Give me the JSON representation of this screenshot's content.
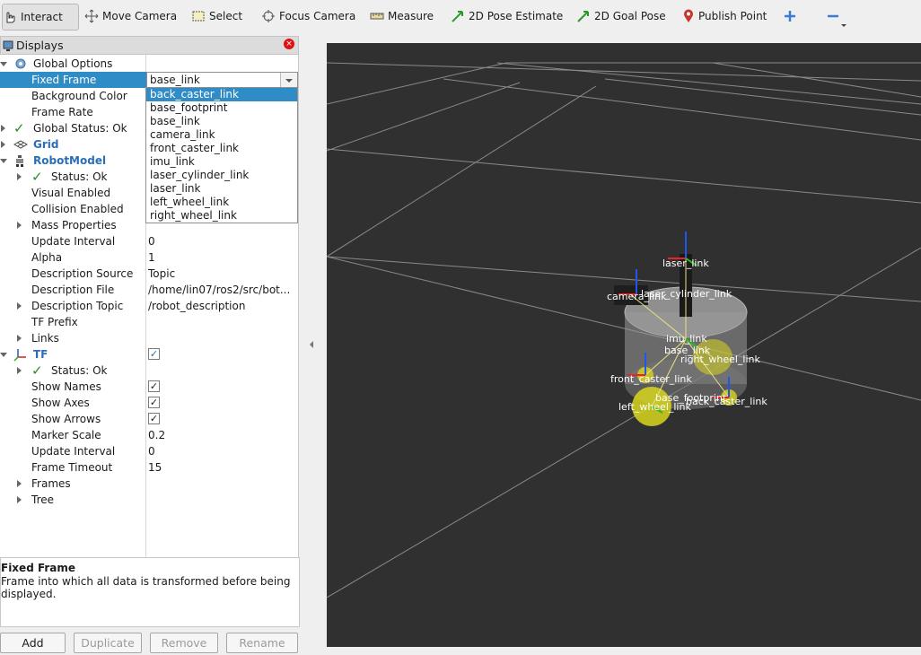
{
  "toolbar": {
    "interact": "Interact",
    "move_camera": "Move Camera",
    "select": "Select",
    "focus_camera": "Focus Camera",
    "measure": "Measure",
    "pose_estimate": "2D Pose Estimate",
    "goal_pose": "2D Goal Pose",
    "publish_point": "Publish Point"
  },
  "displays": {
    "title": "Displays",
    "close_glyph": "×",
    "global_options": "Global Options",
    "fixed_frame_label": "Fixed Frame",
    "fixed_frame_value": "base_link",
    "background_color": "Background Color",
    "frame_rate": "Frame Rate",
    "global_status": "Global Status: Ok",
    "grid": "Grid",
    "robot_model": "RobotModel",
    "rm_status": "Status: Ok",
    "visual_enabled": "Visual Enabled",
    "collision_enabled": "Collision Enabled",
    "mass_properties": "Mass Properties",
    "update_interval": "Update Interval",
    "update_interval_value": "0",
    "alpha": "Alpha",
    "alpha_value": "1",
    "description_source": "Description Source",
    "description_source_value": "Topic",
    "description_file": "Description File",
    "description_file_value": "/home/lin07/ros2/src/bot...",
    "description_topic": "Description Topic",
    "description_topic_value": "/robot_description",
    "tf_prefix": "TF Prefix",
    "links": "Links",
    "tf": "TF",
    "tf_status": "Status: Ok",
    "show_names": "Show Names",
    "show_axes": "Show Axes",
    "show_arrows": "Show Arrows",
    "marker_scale": "Marker Scale",
    "marker_scale_value": "0.2",
    "tf_update_interval": "Update Interval",
    "tf_update_interval_value": "0",
    "frame_timeout": "Frame Timeout",
    "frame_timeout_value": "15",
    "frames": "Frames",
    "tree": "Tree",
    "check_glyph": "✓"
  },
  "frame_options": [
    "back_caster_link",
    "base_footprint",
    "base_link",
    "camera_link",
    "front_caster_link",
    "imu_link",
    "laser_cylinder_link",
    "laser_link",
    "left_wheel_link",
    "right_wheel_link"
  ],
  "description": {
    "title": "Fixed Frame",
    "body": "Frame into which all data is transformed before being displayed."
  },
  "buttons": {
    "add": "Add",
    "duplicate": "Duplicate",
    "remove": "Remove",
    "rename": "Rename"
  },
  "scene_labels": {
    "laser_link": "laser_link",
    "camera_link": "camera_link",
    "laser_cylinder_link": "laser_cylinder_link",
    "imu_link": "imu_link",
    "base_link": "base_link",
    "right_wheel_link": "right_wheel_link",
    "front_caster_link": "front_caster_link",
    "base_footprint": "base_footprint",
    "left_wheel_link": "left_wheel_link",
    "back_caster_link": "back_caster_link"
  },
  "colors": {
    "accent": "#308cc6",
    "viewport_bg": "#303030",
    "grid_line": "#8a8a8a",
    "check": "#2a8a2a",
    "wheel": "#d8d61c"
  }
}
